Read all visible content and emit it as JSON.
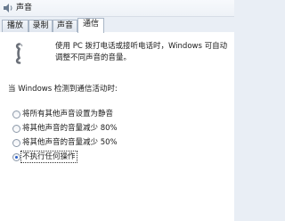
{
  "window": {
    "title": "声音"
  },
  "tabs": [
    {
      "label": "播放",
      "active": false
    },
    {
      "label": "录制",
      "active": false
    },
    {
      "label": "声音",
      "active": false
    },
    {
      "label": "通信",
      "active": true
    }
  ],
  "communications": {
    "description": "使用 PC 拨打电话或接听电话时，Windows 可自动调整不同声音的音量。",
    "prompt": "当 Windows 检测到通信活动时:",
    "options": [
      {
        "label": "将所有其他声音设置为静音",
        "selected": false
      },
      {
        "label": "将其他声音的音量减少 80%",
        "selected": false
      },
      {
        "label": "将其他声音的音量减少 50%",
        "selected": false
      },
      {
        "label": "不执行任何操作",
        "selected": true
      }
    ]
  },
  "icons": {
    "app": "speaker-icon",
    "phone": "phone-icon"
  }
}
